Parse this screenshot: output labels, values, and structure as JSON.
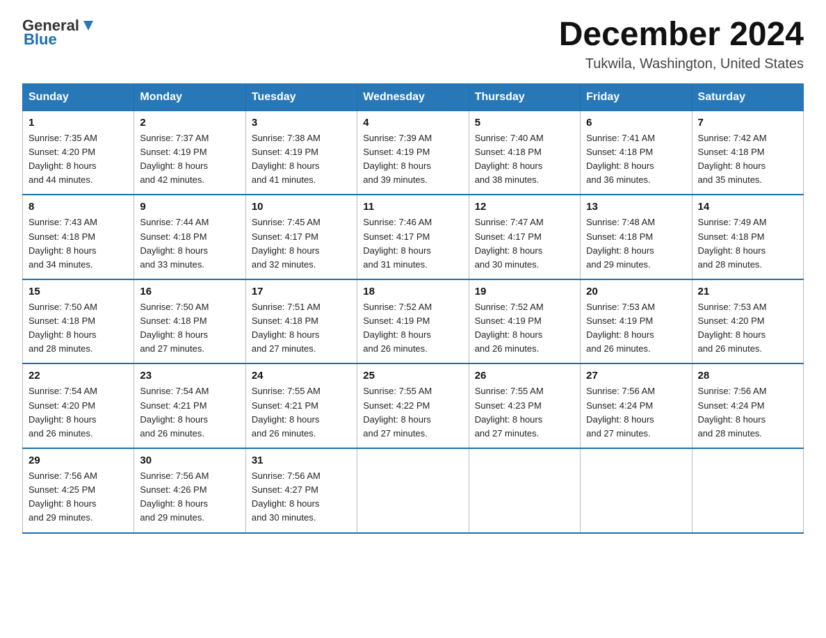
{
  "header": {
    "logo_general": "General",
    "logo_blue": "Blue",
    "month_title": "December 2024",
    "subtitle": "Tukwila, Washington, United States"
  },
  "weekdays": [
    "Sunday",
    "Monday",
    "Tuesday",
    "Wednesday",
    "Thursday",
    "Friday",
    "Saturday"
  ],
  "weeks": [
    [
      {
        "day": "1",
        "sunrise": "7:35 AM",
        "sunset": "4:20 PM",
        "daylight": "8 hours and 44 minutes."
      },
      {
        "day": "2",
        "sunrise": "7:37 AM",
        "sunset": "4:19 PM",
        "daylight": "8 hours and 42 minutes."
      },
      {
        "day": "3",
        "sunrise": "7:38 AM",
        "sunset": "4:19 PM",
        "daylight": "8 hours and 41 minutes."
      },
      {
        "day": "4",
        "sunrise": "7:39 AM",
        "sunset": "4:19 PM",
        "daylight": "8 hours and 39 minutes."
      },
      {
        "day": "5",
        "sunrise": "7:40 AM",
        "sunset": "4:18 PM",
        "daylight": "8 hours and 38 minutes."
      },
      {
        "day": "6",
        "sunrise": "7:41 AM",
        "sunset": "4:18 PM",
        "daylight": "8 hours and 36 minutes."
      },
      {
        "day": "7",
        "sunrise": "7:42 AM",
        "sunset": "4:18 PM",
        "daylight": "8 hours and 35 minutes."
      }
    ],
    [
      {
        "day": "8",
        "sunrise": "7:43 AM",
        "sunset": "4:18 PM",
        "daylight": "8 hours and 34 minutes."
      },
      {
        "day": "9",
        "sunrise": "7:44 AM",
        "sunset": "4:18 PM",
        "daylight": "8 hours and 33 minutes."
      },
      {
        "day": "10",
        "sunrise": "7:45 AM",
        "sunset": "4:17 PM",
        "daylight": "8 hours and 32 minutes."
      },
      {
        "day": "11",
        "sunrise": "7:46 AM",
        "sunset": "4:17 PM",
        "daylight": "8 hours and 31 minutes."
      },
      {
        "day": "12",
        "sunrise": "7:47 AM",
        "sunset": "4:17 PM",
        "daylight": "8 hours and 30 minutes."
      },
      {
        "day": "13",
        "sunrise": "7:48 AM",
        "sunset": "4:18 PM",
        "daylight": "8 hours and 29 minutes."
      },
      {
        "day": "14",
        "sunrise": "7:49 AM",
        "sunset": "4:18 PM",
        "daylight": "8 hours and 28 minutes."
      }
    ],
    [
      {
        "day": "15",
        "sunrise": "7:50 AM",
        "sunset": "4:18 PM",
        "daylight": "8 hours and 28 minutes."
      },
      {
        "day": "16",
        "sunrise": "7:50 AM",
        "sunset": "4:18 PM",
        "daylight": "8 hours and 27 minutes."
      },
      {
        "day": "17",
        "sunrise": "7:51 AM",
        "sunset": "4:18 PM",
        "daylight": "8 hours and 27 minutes."
      },
      {
        "day": "18",
        "sunrise": "7:52 AM",
        "sunset": "4:19 PM",
        "daylight": "8 hours and 26 minutes."
      },
      {
        "day": "19",
        "sunrise": "7:52 AM",
        "sunset": "4:19 PM",
        "daylight": "8 hours and 26 minutes."
      },
      {
        "day": "20",
        "sunrise": "7:53 AM",
        "sunset": "4:19 PM",
        "daylight": "8 hours and 26 minutes."
      },
      {
        "day": "21",
        "sunrise": "7:53 AM",
        "sunset": "4:20 PM",
        "daylight": "8 hours and 26 minutes."
      }
    ],
    [
      {
        "day": "22",
        "sunrise": "7:54 AM",
        "sunset": "4:20 PM",
        "daylight": "8 hours and 26 minutes."
      },
      {
        "day": "23",
        "sunrise": "7:54 AM",
        "sunset": "4:21 PM",
        "daylight": "8 hours and 26 minutes."
      },
      {
        "day": "24",
        "sunrise": "7:55 AM",
        "sunset": "4:21 PM",
        "daylight": "8 hours and 26 minutes."
      },
      {
        "day": "25",
        "sunrise": "7:55 AM",
        "sunset": "4:22 PM",
        "daylight": "8 hours and 27 minutes."
      },
      {
        "day": "26",
        "sunrise": "7:55 AM",
        "sunset": "4:23 PM",
        "daylight": "8 hours and 27 minutes."
      },
      {
        "day": "27",
        "sunrise": "7:56 AM",
        "sunset": "4:24 PM",
        "daylight": "8 hours and 27 minutes."
      },
      {
        "day": "28",
        "sunrise": "7:56 AM",
        "sunset": "4:24 PM",
        "daylight": "8 hours and 28 minutes."
      }
    ],
    [
      {
        "day": "29",
        "sunrise": "7:56 AM",
        "sunset": "4:25 PM",
        "daylight": "8 hours and 29 minutes."
      },
      {
        "day": "30",
        "sunrise": "7:56 AM",
        "sunset": "4:26 PM",
        "daylight": "8 hours and 29 minutes."
      },
      {
        "day": "31",
        "sunrise": "7:56 AM",
        "sunset": "4:27 PM",
        "daylight": "8 hours and 30 minutes."
      },
      null,
      null,
      null,
      null
    ]
  ],
  "labels": {
    "sunrise": "Sunrise:",
    "sunset": "Sunset:",
    "daylight": "Daylight:"
  }
}
